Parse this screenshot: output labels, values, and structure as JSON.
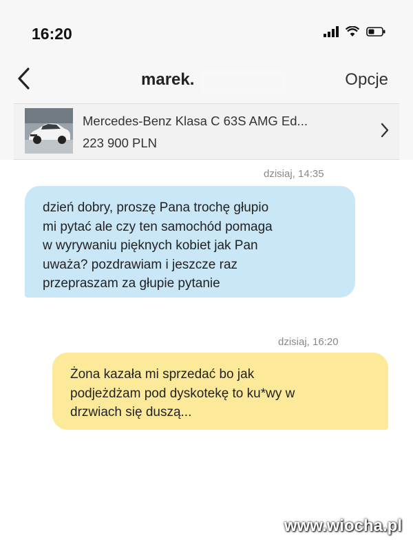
{
  "status_bar": {
    "time": "16:20",
    "icons": [
      "signal-icon",
      "wifi-icon",
      "battery-icon"
    ]
  },
  "nav": {
    "back_icon": "chevron-left-icon",
    "title": "marek.",
    "options_label": "Opcje"
  },
  "listing": {
    "thumbnail": "car-photo",
    "title": "Mercedes-Benz Klasa C 63S AMG Ed...",
    "price": "223 900 PLN",
    "chevron_icon": "chevron-right-icon"
  },
  "messages": [
    {
      "direction": "incoming",
      "timestamp": "dzisiaj, 14:35",
      "text": "dzień dobry, proszę Pana trochę głupio\nmi pytać ale czy ten samochód pomaga\nw wyrywaniu pięknych kobiet jak Pan\nuważa? pozdrawiam i jeszcze raz\nprzepraszam za głupie pytanie",
      "color": "#c9e7f6"
    },
    {
      "direction": "outgoing",
      "timestamp": "dzisiaj, 16:20",
      "text": "Żona kazała mi sprzedać bo jak\npodjeżdżam pod dyskotekę to ku*wy w\ndrzwiach się duszą...",
      "color": "#fcea9a"
    }
  ],
  "watermark": "www.wiocha.pl"
}
